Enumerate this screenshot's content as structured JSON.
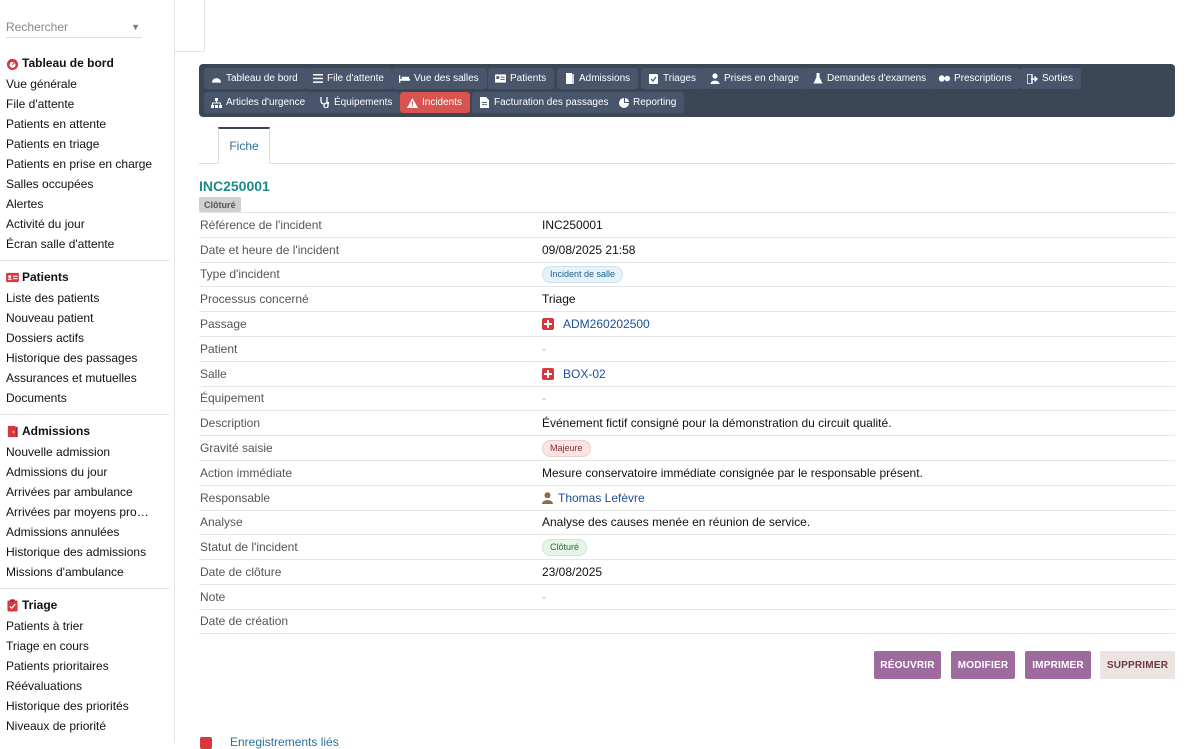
{
  "sidebar": {
    "search_placeholder": "Rechercher",
    "sections": [
      {
        "title": "Tableau de bord",
        "items": [
          "Vue générale",
          "File d'attente",
          "Patients en attente",
          "Patients en triage",
          "Patients en prise en charge",
          "Salles occupées",
          "Alertes",
          "Activité du jour",
          "Écran salle d'attente"
        ]
      },
      {
        "title": "Patients",
        "items": [
          "Liste des patients",
          "Nouveau patient",
          "Dossiers actifs",
          "Historique des passages",
          "Assurances et mutuelles",
          "Documents"
        ]
      },
      {
        "title": "Admissions",
        "items": [
          "Nouvelle admission",
          "Admissions du jour",
          "Arrivées par ambulance",
          "Arrivées par moyens pro…",
          "Admissions annulées",
          "Historique des admissions",
          "Missions d'ambulance"
        ]
      },
      {
        "title": "Triage",
        "items": [
          "Patients à trier",
          "Triage en cours",
          "Patients prioritaires",
          "Réévaluations",
          "Historique des priorités",
          "Niveaux de priorité"
        ]
      }
    ]
  },
  "toolbar": {
    "row1": [
      "Tableau de bord",
      "File d'attente",
      "Vue des salles",
      "Patients",
      "Admissions",
      "Triages",
      "Prises en charge",
      "Demandes d'examens",
      "Prescriptions",
      "Sorties"
    ],
    "row2": [
      "Articles d'urgence",
      "Équipements",
      "Incidents",
      "Facturation des passages",
      "Reporting"
    ]
  },
  "tabs": {
    "fiche": "Fiche"
  },
  "record": {
    "title": "INC250001",
    "status_badge": "Clôturé",
    "fields": {
      "reference": {
        "label": "Référence de l'incident",
        "value": "INC250001"
      },
      "datetime": {
        "label": "Date et heure de l'incident",
        "value": "09/08/2025 21:58"
      },
      "type": {
        "label": "Type d'incident",
        "value": "Incident de salle"
      },
      "process": {
        "label": "Processus concerné",
        "value": "Triage"
      },
      "passage": {
        "label": "Passage",
        "value": "ADM260202500"
      },
      "patient": {
        "label": "Patient",
        "value": "-"
      },
      "salle": {
        "label": "Salle",
        "value": "BOX-02"
      },
      "equipement": {
        "label": "Équipement",
        "value": "-"
      },
      "description": {
        "label": "Description",
        "value": "Événement fictif consigné pour la démonstration du circuit qualité."
      },
      "gravite": {
        "label": "Gravité saisie",
        "value": "Majeure"
      },
      "action": {
        "label": "Action immédiate",
        "value": "Mesure conservatoire immédiate consignée par le responsable présent."
      },
      "responsable": {
        "label": "Responsable",
        "value": "Thomas Lefèvre"
      },
      "analyse": {
        "label": "Analyse",
        "value": "Analyse des causes menée en réunion de service."
      },
      "statut": {
        "label": "Statut de l'incident",
        "value": "Clôturé"
      },
      "cloture": {
        "label": "Date de clôture",
        "value": "23/08/2025"
      },
      "note": {
        "label": "Note",
        "value": "-"
      },
      "creation": {
        "label": "Date de création",
        "value": ""
      }
    }
  },
  "actions": {
    "reopen": "RÉOUVRIR",
    "edit": "MODIFIER",
    "print": "IMPRIMER",
    "delete": "SUPPRIMER"
  },
  "footer": {
    "related": "Enregistrements liés"
  },
  "colors": {
    "toolbar_bg": "#3b4755",
    "active_tab": "#d9534f",
    "action_purple": "#9d6b9d",
    "title_teal": "#1f8a8a"
  }
}
